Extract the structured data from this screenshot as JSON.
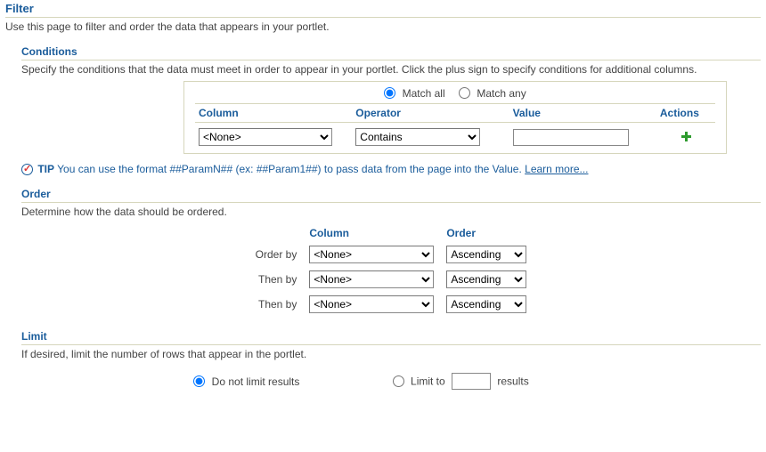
{
  "filter": {
    "title": "Filter",
    "desc": "Use this page to filter and order the data that appears in your portlet."
  },
  "conditions": {
    "title": "Conditions",
    "desc": "Specify the conditions that the data must meet in order to appear in your portlet. Click the plus sign to specify conditions for additional columns.",
    "match_all_label": "Match all",
    "match_any_label": "Match any",
    "match_selected": "all",
    "headers": {
      "column": "Column",
      "operator": "Operator",
      "value": "Value",
      "actions": "Actions"
    },
    "row": {
      "column_value": "<None>",
      "operator_value": "Contains",
      "value_value": ""
    }
  },
  "tip": {
    "label": "TIP",
    "text": "You can use the format ##ParamN## (ex: ##Param1##) to pass data from the page into the Value.",
    "learn_more": "Learn more..."
  },
  "order": {
    "title": "Order",
    "desc": "Determine how the data should be ordered.",
    "headers": {
      "column": "Column",
      "order": "Order"
    },
    "rows": [
      {
        "label": "Order by",
        "column": "<None>",
        "order": "Ascending"
      },
      {
        "label": "Then by",
        "column": "<None>",
        "order": "Ascending"
      },
      {
        "label": "Then by",
        "column": "<None>",
        "order": "Ascending"
      }
    ]
  },
  "limit": {
    "title": "Limit",
    "desc": "If desired, limit the number of rows that appear in the portlet.",
    "no_limit_label": "Do not limit results",
    "limit_to_label": "Limit to",
    "results_label": "results",
    "selected": "no_limit",
    "limit_value": ""
  }
}
